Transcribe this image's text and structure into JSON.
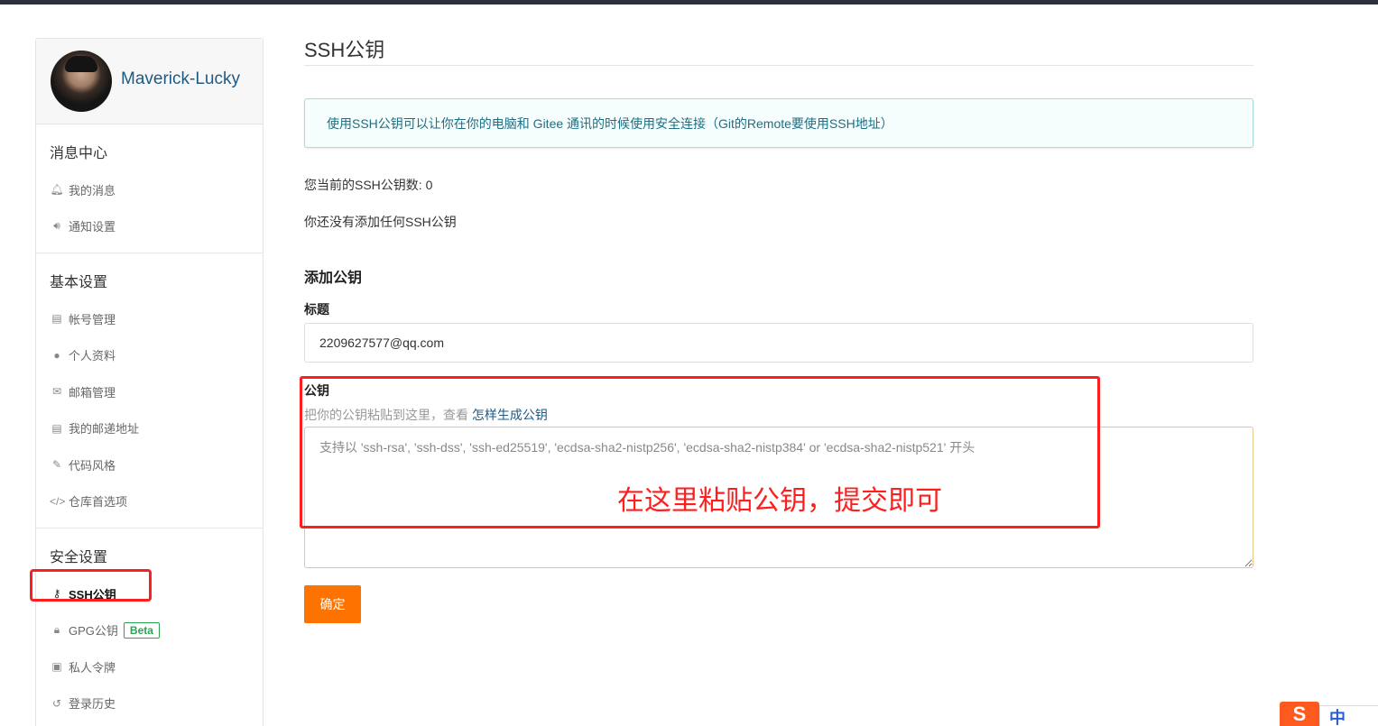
{
  "user": {
    "name": "Maverick-Lucky"
  },
  "sidebar": {
    "sections": [
      {
        "title": "消息中心",
        "items": [
          {
            "label": "我的消息",
            "icon": "bell-icon"
          },
          {
            "label": "通知设置",
            "icon": "volume-icon"
          }
        ]
      },
      {
        "title": "基本设置",
        "items": [
          {
            "label": "帐号管理",
            "icon": "id-card-icon"
          },
          {
            "label": "个人资料",
            "icon": "user-icon"
          },
          {
            "label": "邮箱管理",
            "icon": "envelope-icon"
          },
          {
            "label": "我的邮递地址",
            "icon": "address-card-icon"
          },
          {
            "label": "代码风格",
            "icon": "brush-icon"
          },
          {
            "label": "仓库首选项",
            "icon": "code-icon"
          }
        ]
      },
      {
        "title": "安全设置",
        "items": [
          {
            "label": "SSH公钥",
            "icon": "key-icon",
            "active": true
          },
          {
            "label": "GPG公钥",
            "icon": "lock-icon",
            "badge": "Beta"
          },
          {
            "label": "私人令牌",
            "icon": "token-icon"
          },
          {
            "label": "登录历史",
            "icon": "history-icon"
          }
        ]
      }
    ]
  },
  "main": {
    "title": "SSH公钥",
    "info": "使用SSH公钥可以让你在你的电脑和 Gitee 通讯的时候使用安全连接（Git的Remote要使用SSH地址）",
    "count_text": "您当前的SSH公钥数: 0",
    "empty_text": "你还没有添加任何SSH公钥",
    "add_title": "添加公钥",
    "title_label": "标题",
    "title_value": "2209627577@qq.com",
    "key_label": "公钥",
    "hint_prefix": "把你的公钥粘贴到这里，查看 ",
    "hint_link": "怎样生成公钥",
    "key_placeholder": "支持以 'ssh-rsa', 'ssh-dss', 'ssh-ed25519', 'ecdsa-sha2-nistp256', 'ecdsa-sha2-nistp384' or 'ecdsa-sha2-nistp521' 开头",
    "submit_label": "确定"
  },
  "annotation": {
    "text": "在这里粘贴公钥，提交即可",
    "color": "#ff1e1e"
  },
  "colors": {
    "accent": "#fe7300",
    "link": "#1e5a84",
    "beta": "#2aa44f"
  },
  "corner_widget": {
    "logo": "S",
    "text": "中"
  }
}
